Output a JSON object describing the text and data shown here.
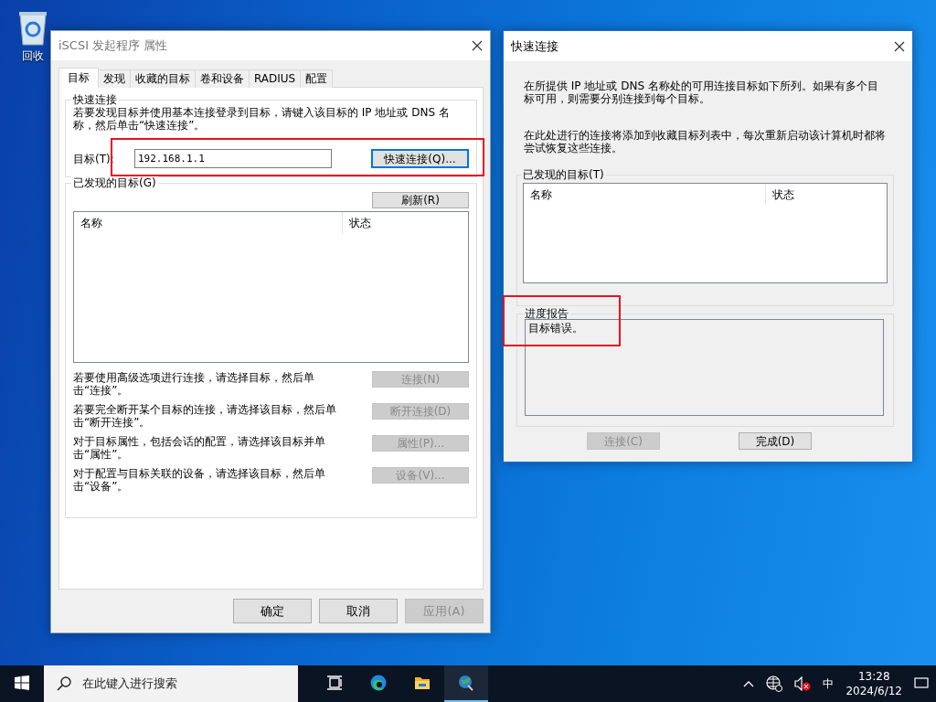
{
  "desktop": {
    "icons": [
      {
        "label": "回收"
      }
    ]
  },
  "main_window": {
    "title": "iSCSI 发起程序 属性",
    "tabs": [
      {
        "label": "目标",
        "selected": true
      },
      {
        "label": "发现",
        "selected": false
      },
      {
        "label": "收藏的目标",
        "selected": false
      },
      {
        "label": "卷和设备",
        "selected": false
      },
      {
        "label": "RADIUS",
        "selected": false
      },
      {
        "label": "配置",
        "selected": false
      }
    ],
    "quick_connect": {
      "title": "快速连接",
      "highlighted": true,
      "description": "若要发现目标并使用基本连接登录到目标，请键入该目标的 IP 地址或 DNS 名称，然后单击“快速连接”。",
      "target_label": "目标(T):",
      "target_value": "192.168.1.1",
      "button": {
        "label": "快速连接(Q)...",
        "default": true,
        "disabled": false
      }
    },
    "discovered": {
      "title": "已发现的目标(G)",
      "refresh": {
        "label": "刷新(R)",
        "disabled": false
      },
      "columns": [
        "名称",
        "状态"
      ],
      "actions": [
        {
          "text": "若要使用高级选项进行连接，请选择目标，然后单击“连接”。",
          "button": {
            "label": "连接(N)",
            "disabled": true
          }
        },
        {
          "text": "若要完全断开某个目标的连接，请选择该目标，然后单击“断开连接”。",
          "button": {
            "label": "断开连接(D)",
            "disabled": true
          }
        },
        {
          "text": "对于目标属性，包括会话的配置，请选择该目标并单击“属性”。",
          "button": {
            "label": "属性(P)...",
            "disabled": true
          }
        },
        {
          "text": "对于配置与目标关联的设备，请选择该目标，然后单击“设备”。",
          "button": {
            "label": "设备(V)...",
            "disabled": true
          }
        }
      ]
    },
    "buttons": [
      {
        "label": "确定",
        "disabled": false
      },
      {
        "label": "取消",
        "disabled": false
      },
      {
        "label": "应用(A)",
        "disabled": true
      }
    ]
  },
  "quick_window": {
    "title": "快速连接",
    "paragraphs": [
      "在所提供 IP 地址或 DNS 名称处的可用连接目标如下所列。如果有多个目标可用，则需要分别连接到每个目标。",
      "在此处进行的连接将添加到收藏目标列表中，每次重新启动该计算机时都将尝试恢复这些连接。"
    ],
    "discovered": {
      "title": "已发现的目标(T)",
      "columns": [
        "名称",
        "状态"
      ]
    },
    "progress": {
      "title": "进度报告",
      "highlighted": true,
      "text": "目标错误。"
    },
    "buttons": [
      {
        "label": "连接(C)",
        "disabled": true
      },
      {
        "label": "完成(D)",
        "disabled": false
      }
    ]
  },
  "taskbar": {
    "search_placeholder": "在此键入进行搜索",
    "apps": [
      {
        "kind": "taskview",
        "active": false
      },
      {
        "kind": "edge",
        "active": false
      },
      {
        "kind": "explorer",
        "active": false
      },
      {
        "kind": "iscsi",
        "active": true
      }
    ],
    "tray": {
      "ime": "中",
      "time": "13:28",
      "date": "2024/6/12"
    }
  }
}
